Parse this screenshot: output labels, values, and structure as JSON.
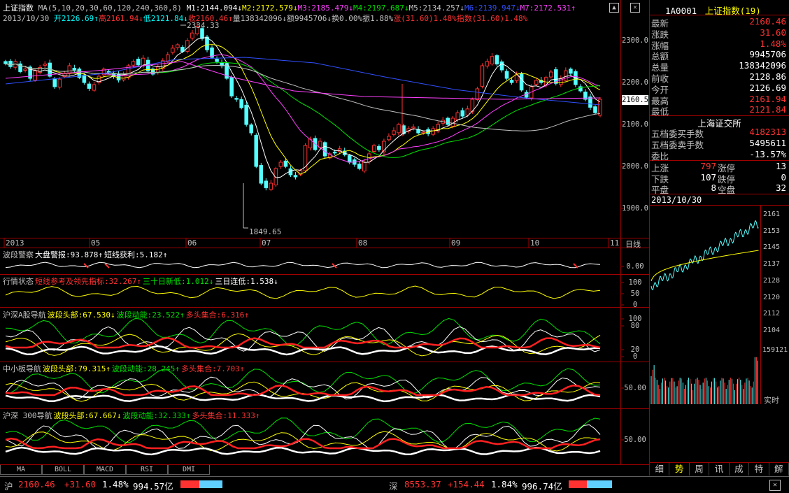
{
  "main": {
    "title": "上证指数",
    "ma_params": "MA(5,10,20,30,60,120,240,360,8)",
    "ma": [
      {
        "label": "M1:2144.094↓",
        "color": "#ffffff"
      },
      {
        "label": "M2:2172.579↓",
        "color": "#ffff00"
      },
      {
        "label": "M3:2185.479↓",
        "color": "#ff40ff"
      },
      {
        "label": "M4:2197.687↓",
        "color": "#00e000"
      },
      {
        "label": "M5:2134.257↓",
        "color": "#c0c0c0"
      },
      {
        "label": "M6:2139.947↓",
        "color": "#3050ff"
      },
      {
        "label": "M7:2172.531↑",
        "color": "#ff40ff"
      }
    ],
    "date": "2013/10/30",
    "ohlc": [
      {
        "label": "开2126.69↑",
        "color": "#00ffff"
      },
      {
        "label": "高2161.94↓",
        "color": "#ff3232"
      },
      {
        "label": "低2121.84↓",
        "color": "#00ffff"
      },
      {
        "label": "收2160.46↑",
        "color": "#ff3232"
      },
      {
        "label": "量138342096↓",
        "color": "#c0c0c0"
      },
      {
        "label": "额9945706↓",
        "color": "#c0c0c0"
      },
      {
        "label": "换0.00%",
        "color": "#c0c0c0"
      },
      {
        "label": "振1.88%",
        "color": "#c0c0c0"
      },
      {
        "label": "涨(31.60)1.48%",
        "color": "#ff3232"
      },
      {
        "label": "指数(31.60)1.48%",
        "color": "#ff3232"
      }
    ],
    "high_mark": "2334.33",
    "low_mark": "1849.65",
    "price_tag": "2160.5",
    "y_ticks": [
      "2300.0",
      "2200.0",
      "2100.0",
      "2000.0",
      "1900.0"
    ],
    "x_labels": [
      "2013",
      "05",
      "06",
      "07",
      "08",
      "09",
      "10",
      "11"
    ],
    "period": "日线"
  },
  "indicators": [
    {
      "name": "波段警察",
      "parts": [
        {
          "t": "大盘警报:93.878↑",
          "c": "#ffffff"
        },
        {
          "t": "短线获利:5.182↑",
          "c": "#ffffff"
        }
      ],
      "scale": [
        "0.00"
      ]
    },
    {
      "name": "行情状态",
      "parts": [
        {
          "t": "短线参考及领先指标:32.267↑",
          "c": "#ff3232"
        },
        {
          "t": "三十日新低:1.012↓",
          "c": "#00e000"
        },
        {
          "t": "三日连低:1.538↓",
          "c": "#ffffff"
        }
      ],
      "scale": [
        "100",
        "50",
        "0"
      ]
    },
    {
      "name": "沪深A股导航",
      "parts": [
        {
          "t": "波段头部:67.530↓",
          "c": "#ffff00"
        },
        {
          "t": "波段动能:23.522↑",
          "c": "#00e000"
        },
        {
          "t": "多头集合:6.316↑",
          "c": "#ff3232"
        }
      ],
      "scale": [
        "100",
        "80",
        "20",
        "0"
      ]
    },
    {
      "name": "中小板导航",
      "parts": [
        {
          "t": "波段头部:79.315↑",
          "c": "#ffff00"
        },
        {
          "t": "波段动能:28.245↑",
          "c": "#00e000"
        },
        {
          "t": "多头集合:7.703↑",
          "c": "#ff3232"
        }
      ],
      "scale": [
        "50.00"
      ]
    },
    {
      "name": "沪深 300导航",
      "parts": [
        {
          "t": "波段头部:67.667↓",
          "c": "#ffff00"
        },
        {
          "t": "波段动能:32.333↑",
          "c": "#00e000"
        },
        {
          "t": "多头集合:11.333↑",
          "c": "#ff3232"
        }
      ],
      "scale": [
        "50.00"
      ]
    }
  ],
  "tabs": [
    "MA",
    "BOLL",
    "MACD",
    "RSI",
    "DMI"
  ],
  "right": {
    "code": "1A0001",
    "name": "上证指数(19)",
    "quote": [
      {
        "k": "最新",
        "v": "2160.46",
        "c": "#ff3232"
      },
      {
        "k": "涨跌",
        "v": "31.60",
        "c": "#ff3232"
      },
      {
        "k": "涨幅",
        "v": "1.48%",
        "c": "#ff3232"
      },
      {
        "k": "总额",
        "v": "9945706",
        "c": "#ffffff"
      },
      {
        "k": "总量",
        "v": "138342096",
        "c": "#ffffff"
      },
      {
        "k": "前收",
        "v": "2128.86",
        "c": "#ffffff"
      },
      {
        "k": "今开",
        "v": "2126.69",
        "c": "#ffffff"
      },
      {
        "k": "最高",
        "v": "2161.94",
        "c": "#ff3232"
      },
      {
        "k": "最低",
        "v": "2121.84",
        "c": "#ff3232"
      }
    ],
    "exchange": "上海证交所",
    "queue": [
      {
        "k": "五档委买手数",
        "v": "4182313",
        "c": "#ff3232"
      },
      {
        "k": "五档委卖手数",
        "v": "5495611",
        "c": "#ffffff"
      },
      {
        "k": "委比",
        "v": "-13.57%",
        "c": "#ffffff"
      }
    ],
    "breadth": [
      {
        "k1": "上涨",
        "v1": "797",
        "k2": "涨停",
        "v2": "13"
      },
      {
        "k1": "下跌",
        "v1": "107",
        "k2": "跌停",
        "v2": "0"
      },
      {
        "k1": "平盘",
        "v1": "8",
        "k2": "空盘",
        "v2": "32"
      }
    ],
    "mini_date": "2013/10/30",
    "mini_ticks": [
      "2161",
      "2153",
      "2145",
      "2137",
      "2128",
      "2120",
      "2112",
      "2104"
    ],
    "vol_tick": "159121",
    "realtime": "实时",
    "bottom_tabs": [
      "细",
      "势",
      "周",
      "讯",
      "成",
      "特",
      "解"
    ]
  },
  "status": {
    "sh_label": "沪",
    "sh_value": "2160.46",
    "sh_change": "+31.60",
    "sh_pct": "1.48%",
    "sh_amount": "994.57亿",
    "sz_label": "深",
    "sz_value": "8553.37",
    "sz_change": "+154.44",
    "sz_pct": "1.84%",
    "sz_amount": "996.74亿"
  }
}
